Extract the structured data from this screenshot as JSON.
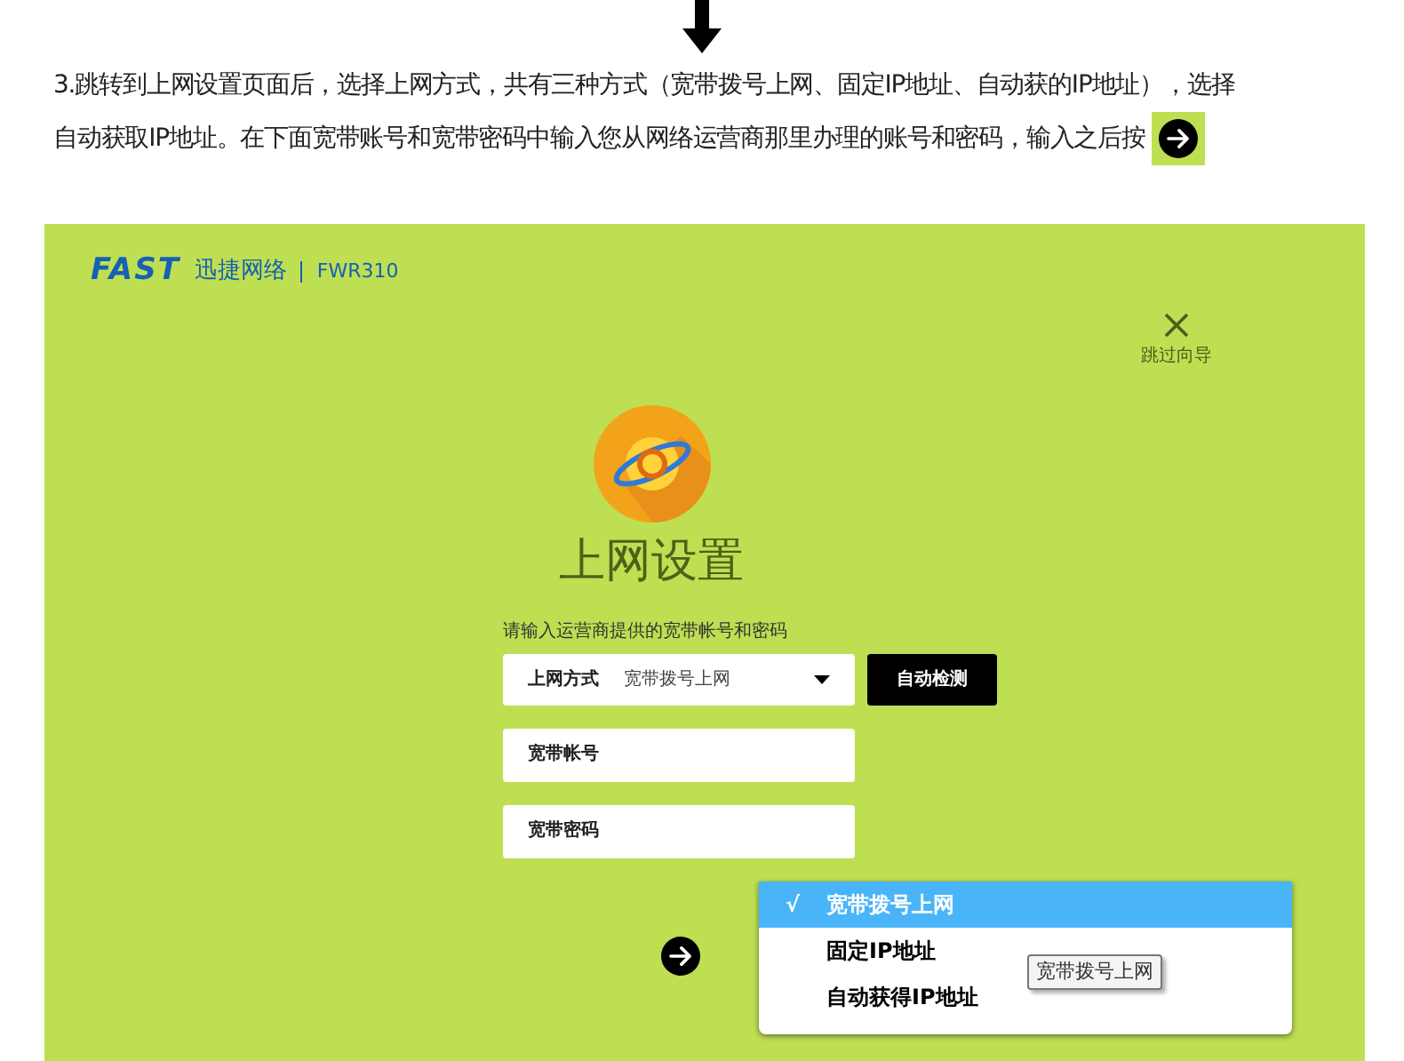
{
  "instruction": {
    "lines": [
      "3.跳转到上网设置页面后，选择上网方式，共有三种方式（宽带拨号上网、固定IP地址、自动获的IP地址），选择",
      "自动获取IP地址。在下面宽带账号和宽带密码中输入您从网络运营商那里办理的账号和密码，输入之后按"
    ]
  },
  "router_page": {
    "brand": "FAST",
    "brand_cn": "迅捷网络",
    "model": "FWR310",
    "skip": "跳过向导",
    "title": "上网设置",
    "hint": "请输入运营商提供的宽带帐号和密码",
    "connection_type": {
      "label": "上网方式",
      "value": "宽带拨号上网"
    },
    "detect_button": "自动检测",
    "fields": [
      {
        "placeholder": "宽带帐号"
      },
      {
        "placeholder": "宽带密码"
      }
    ],
    "dropdown": {
      "check": "√",
      "options": [
        {
          "label": "宽带拨号上网",
          "selected": true
        },
        {
          "label": "固定IP地址",
          "selected": false
        },
        {
          "label": "自动获得IP地址",
          "selected": false
        }
      ]
    },
    "tooltip": "宽带拨号上网"
  }
}
